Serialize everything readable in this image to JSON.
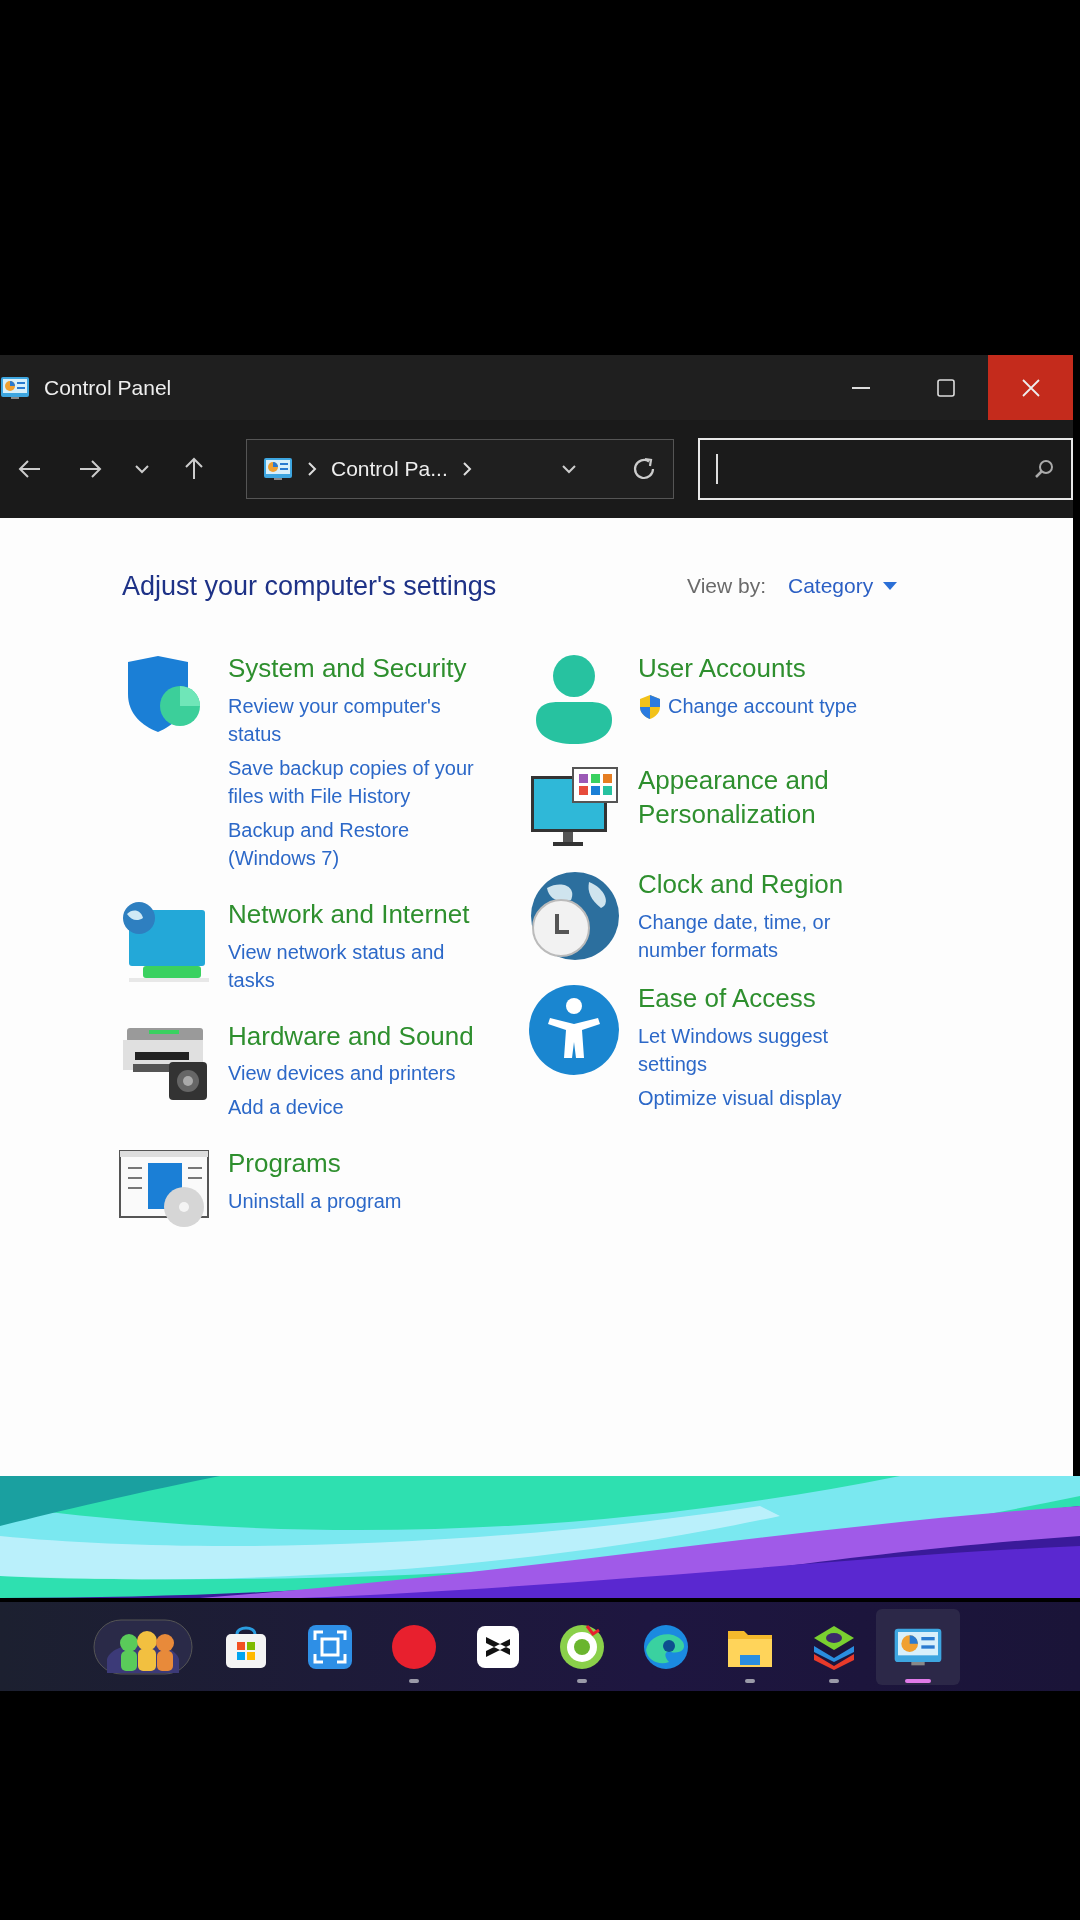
{
  "window": {
    "title": "Control Panel",
    "close_hovered": true
  },
  "toolbar": {
    "address": "Control Pa..."
  },
  "content": {
    "heading": "Adjust your computer's settings",
    "view_by_label": "View by:",
    "view_by_value": "Category",
    "columns": [
      [
        {
          "title": "System and Security",
          "links": [
            {
              "text": "Review your computer's status",
              "shield": false
            },
            {
              "text": "Save backup copies of your files with File History",
              "shield": false
            },
            {
              "text": "Backup and Restore (Windows 7)",
              "shield": false
            }
          ]
        },
        {
          "title": "Network and Internet",
          "links": [
            {
              "text": "View network status and tasks",
              "shield": false
            }
          ]
        },
        {
          "title": "Hardware and Sound",
          "links": [
            {
              "text": "View devices and printers",
              "shield": false
            },
            {
              "text": "Add a device",
              "shield": false
            }
          ]
        },
        {
          "title": "Programs",
          "links": [
            {
              "text": "Uninstall a program",
              "shield": false
            }
          ]
        }
      ],
      [
        {
          "title": "User Accounts",
          "links": [
            {
              "text": "Change account type",
              "shield": true
            }
          ]
        },
        {
          "title": "Appearance and Personalization"
        },
        {
          "title": "Clock and Region",
          "links": [
            {
              "text": "Change date, time, or number formats",
              "shield": false
            }
          ]
        },
        {
          "title": "Ease of Access",
          "links": [
            {
              "text": "Let Windows suggest settings",
              "shield": false
            },
            {
              "text": "Optimize visual display",
              "shield": false
            }
          ]
        }
      ]
    ]
  },
  "taskbar": [
    {
      "running": false,
      "selected": false
    },
    {
      "running": false,
      "selected": false
    },
    {
      "running": false,
      "selected": false
    },
    {
      "running": true,
      "selected": false
    },
    {
      "running": false,
      "selected": false
    },
    {
      "running": true,
      "selected": false
    },
    {
      "running": false,
      "selected": false
    },
    {
      "running": true,
      "selected": false
    },
    {
      "running": true,
      "selected": false
    },
    {
      "running": true,
      "selected": true
    }
  ]
}
